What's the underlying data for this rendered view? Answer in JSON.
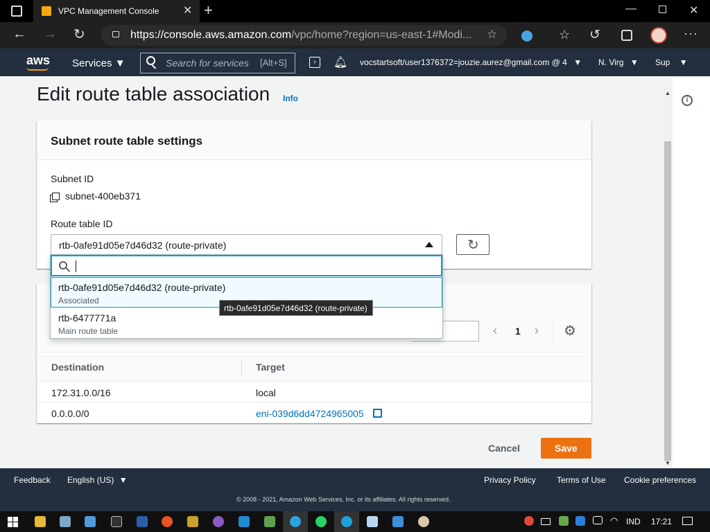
{
  "browser": {
    "tab_title": "VPC Management Console",
    "url_prefix": "https://",
    "url_host": "console.aws.amazon.com",
    "url_path": "/vpc/home?region=us-east-1#Modi..."
  },
  "aws_nav": {
    "logo": "aws",
    "services_label": "Services",
    "search_placeholder": "Search for services",
    "search_shortcut": "[Alt+S]",
    "account": "vocstartsoft/user1376372=jouzie.aurez@gmail.com @ 4",
    "region": "N. Virg",
    "support": "Sup"
  },
  "page": {
    "title": "Edit route table association",
    "info_link": "Info"
  },
  "settings": {
    "header": "Subnet route table settings",
    "subnet_label": "Subnet ID",
    "subnet_value": "subnet-400eb371",
    "route_table_label": "Route table ID",
    "selected_route_table": "rtb-0afe91d05e7d46d32 (route-private)",
    "dropdown_options": [
      {
        "label": "rtb-0afe91d05e7d46d32 (route-private)",
        "description": "Associated"
      },
      {
        "label": "rtb-6477771a",
        "description": "Main route table"
      }
    ],
    "tooltip": "rtb-0afe91d05e7d46d32 (route-private)"
  },
  "routes": {
    "page_number": "1",
    "columns": [
      "Destination",
      "Target"
    ],
    "rows": [
      {
        "destination": "172.31.0.0/16",
        "target": "local"
      },
      {
        "destination": "0.0.0.0/0",
        "target": "eni-039d6dd4724965005"
      }
    ]
  },
  "actions": {
    "cancel": "Cancel",
    "save": "Save"
  },
  "footer": {
    "feedback": "Feedback",
    "language": "English (US)",
    "privacy": "Privacy Policy",
    "terms": "Terms of Use",
    "cookies": "Cookie preferences",
    "copyright": "© 2008 - 2021, Amazon Web Services, Inc. or its affiliates. All rights reserved."
  },
  "taskbar": {
    "language": "IND",
    "time": "17:21"
  },
  "colors": {
    "aws_nav": "#232f3e",
    "accent_orange": "#ec7211",
    "link_blue": "#0073bb",
    "focus_teal": "#00a1c9"
  }
}
